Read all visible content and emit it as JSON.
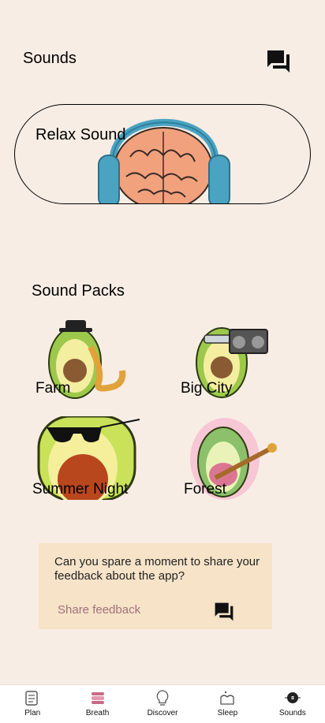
{
  "header": {
    "title": "Sounds"
  },
  "relax": {
    "label": "Relax Sound"
  },
  "packs": {
    "title": "Sound Packs",
    "items": [
      {
        "label": "Farm"
      },
      {
        "label": "Big City"
      },
      {
        "label": "Summer Night"
      },
      {
        "label": "Forest"
      }
    ]
  },
  "feedback": {
    "prompt": "Can you spare a moment to share your feedback about the app?",
    "link": "Share feedback"
  },
  "nav": {
    "items": [
      {
        "label": "Plan",
        "icon": "plan-icon"
      },
      {
        "label": "Breath",
        "icon": "lungs-icon"
      },
      {
        "label": "Discover",
        "icon": "lightbulb-icon"
      },
      {
        "label": "Sleep",
        "icon": "sleep-icon"
      },
      {
        "label": "Sounds",
        "icon": "vinyl-icon"
      }
    ]
  },
  "colors": {
    "background": "#f8ede4",
    "feedback_bg": "#f6e3c8",
    "link": "#a2707a"
  }
}
